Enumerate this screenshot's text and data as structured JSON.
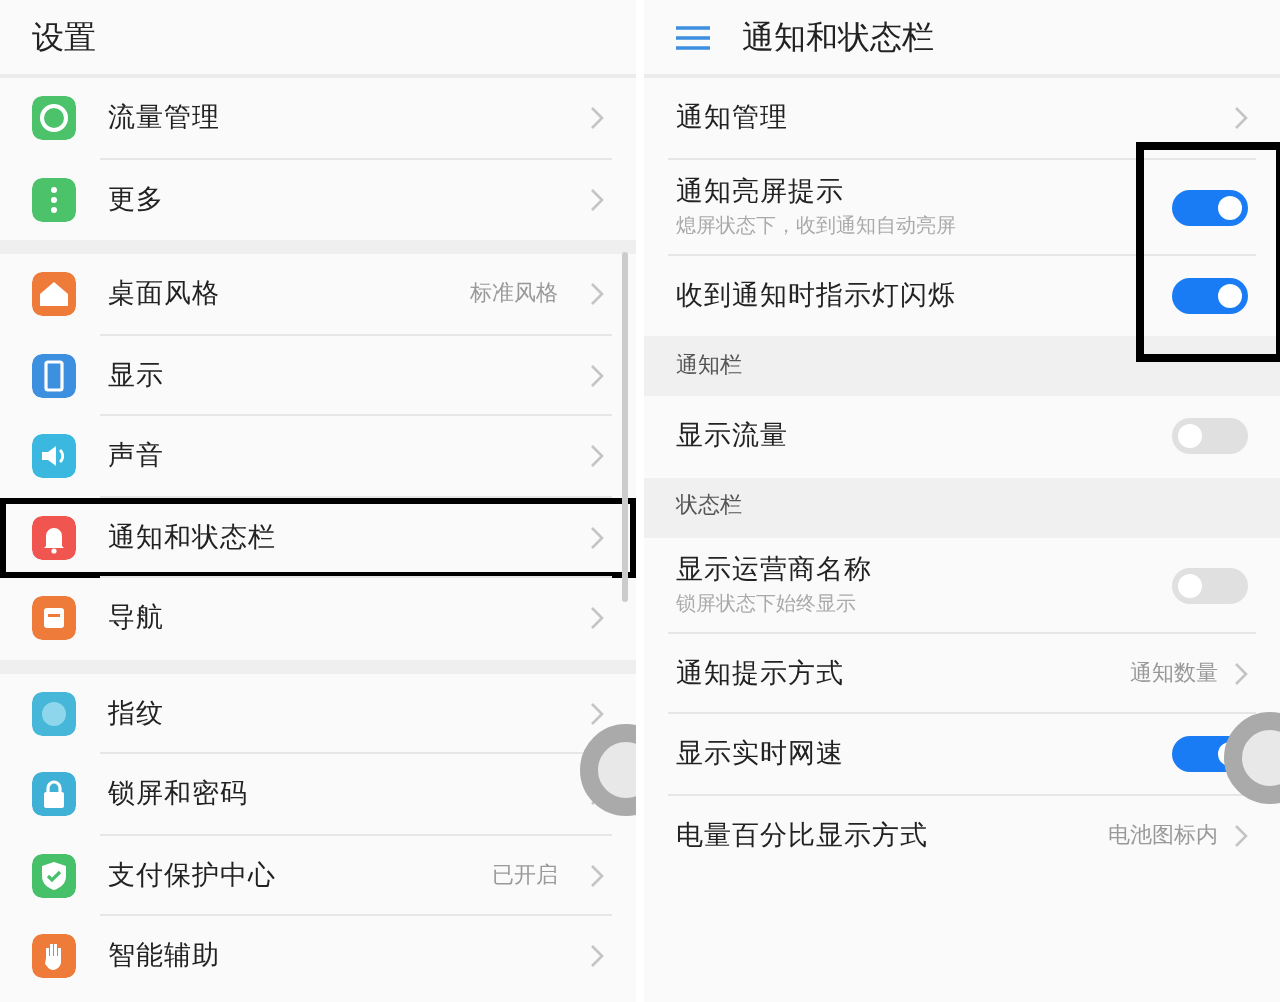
{
  "settings_screen": {
    "title": "设置",
    "groups": [
      {
        "items": [
          {
            "label": "流量管理",
            "color": "#4cc36b",
            "highlighted": false
          },
          {
            "label": "更多",
            "color": "#4cc36b",
            "highlighted": false
          }
        ]
      },
      {
        "items": [
          {
            "label": "桌面风格",
            "value": "标准风格",
            "color": "#ef7b3a",
            "highlighted": false
          },
          {
            "label": "显示",
            "color": "#3d8fe0",
            "highlighted": false
          },
          {
            "label": "声音",
            "color": "#3ab8df",
            "highlighted": false
          },
          {
            "label": "通知和状态栏",
            "color": "#f0564f",
            "highlighted": true
          },
          {
            "label": "导航",
            "color": "#ef7b3a",
            "highlighted": false
          }
        ]
      },
      {
        "items": [
          {
            "label": "指纹",
            "color": "#46b7d9",
            "highlighted": false
          },
          {
            "label": "锁屏和密码",
            "color": "#3fb0d6",
            "highlighted": false
          },
          {
            "label": "支付保护中心",
            "value": "已开启",
            "color": "#47c06a",
            "highlighted": false
          },
          {
            "label": "智能辅助",
            "color": "#ef7b3a",
            "highlighted": false
          }
        ]
      }
    ]
  },
  "notification_screen": {
    "title": "通知和状态栏",
    "rows": [
      {
        "kind": "link",
        "label": "通知管理"
      },
      {
        "kind": "toggle",
        "label": "通知亮屏提示",
        "subtitle": "熄屏状态下，收到通知自动亮屏",
        "on": true,
        "highlighted": true
      },
      {
        "kind": "toggle",
        "label": "收到通知时指示灯闪烁",
        "on": true,
        "highlighted": true
      },
      {
        "kind": "section",
        "label": "通知栏"
      },
      {
        "kind": "toggle",
        "label": "显示流量",
        "on": false,
        "highlighted": false
      },
      {
        "kind": "section",
        "label": "状态栏"
      },
      {
        "kind": "toggle",
        "label": "显示运营商名称",
        "subtitle": "锁屏状态下始终显示",
        "on": false,
        "highlighted": false
      },
      {
        "kind": "link",
        "label": "通知提示方式",
        "value": "通知数量"
      },
      {
        "kind": "toggle",
        "label": "显示实时网速",
        "on": true,
        "highlighted": false
      },
      {
        "kind": "link",
        "label": "电量百分比显示方式",
        "value": "电池图标内"
      }
    ]
  }
}
